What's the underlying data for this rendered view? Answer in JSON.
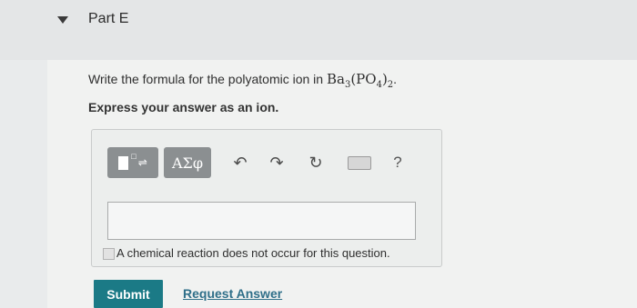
{
  "header": {
    "part_title": "Part E"
  },
  "question": {
    "prefix": "Write the formula for the polyatomic ion in ",
    "formula_parts": [
      "Ba",
      "3",
      "(PO",
      "4",
      ")",
      "2"
    ],
    "suffix": ".",
    "instruction": "Express your answer as an ion."
  },
  "toolbar": {
    "template_button": {
      "icon": "template-icon",
      "label": "□"
    },
    "greek_button": {
      "label": "ΑΣφ"
    },
    "undo": {
      "icon": "undo-icon",
      "glyph": "↶"
    },
    "redo": {
      "icon": "redo-icon",
      "glyph": "↷"
    },
    "reset": {
      "icon": "reset-icon",
      "glyph": "↻"
    },
    "keyboard": {
      "icon": "keyboard-icon"
    },
    "help": {
      "icon": "help-icon",
      "glyph": "?"
    }
  },
  "answer": {
    "value": ""
  },
  "checkbox": {
    "label": "A chemical reaction does not occur for this question.",
    "checked": false
  },
  "actions": {
    "submit_label": "Submit",
    "request_label": "Request Answer"
  },
  "colors": {
    "submit": "#1b7a86",
    "link": "#2f6f89",
    "toolbar_button": "#8b8f91"
  }
}
